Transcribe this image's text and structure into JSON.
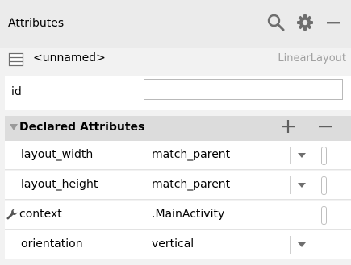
{
  "header": {
    "title": "Attributes",
    "icons": [
      "search-icon",
      "gear-icon",
      "minimize-icon"
    ]
  },
  "component": {
    "name": "<unnamed>",
    "type": "LinearLayout",
    "icon": "layout-icon"
  },
  "id_field": {
    "label": "id",
    "value": ""
  },
  "declared": {
    "title": "Declared Attributes",
    "icons": [
      "collapse-triangle-icon",
      "add-icon",
      "remove-icon"
    ],
    "attributes": [
      {
        "name": "layout_width",
        "value": "match_parent"
      },
      {
        "name": "layout_height",
        "value": "match_parent"
      },
      {
        "name": "context",
        "value": ".MainActivity"
      },
      {
        "name": "orientation",
        "value": "vertical"
      }
    ]
  }
}
